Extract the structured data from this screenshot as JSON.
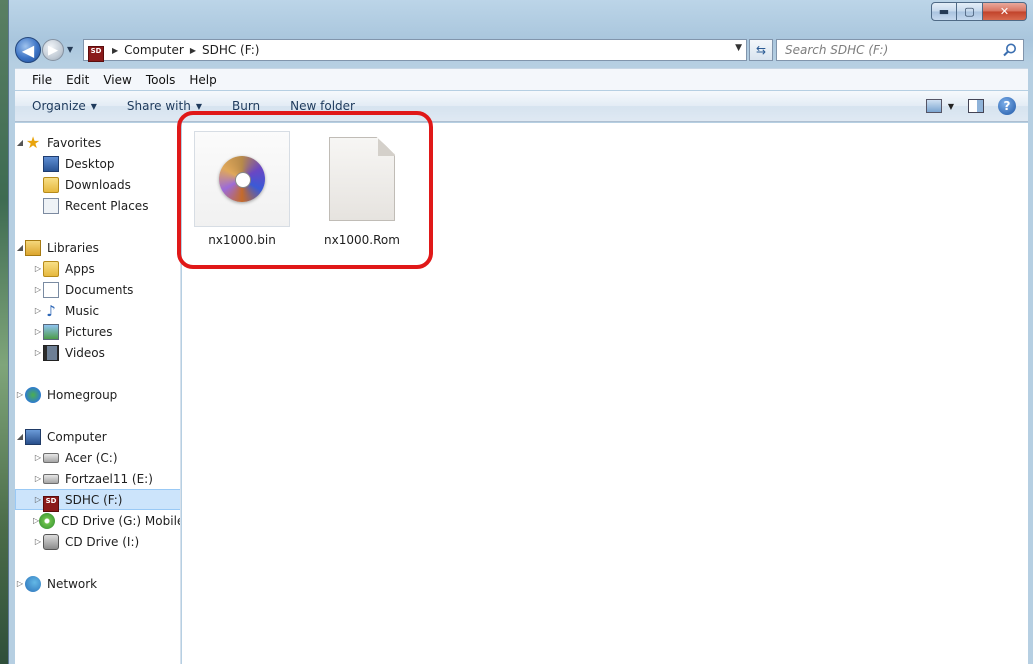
{
  "window": {
    "caption_buttons": {
      "minimize": "▬",
      "maximize": "▢",
      "close": "✕"
    }
  },
  "navigation": {
    "back": "◀",
    "forward": "▶",
    "address_icon": "SD",
    "breadcrumb": [
      "Computer",
      "SDHC (F:)"
    ],
    "search_placeholder": "Search SDHC (F:)"
  },
  "menubar": {
    "items": [
      "File",
      "Edit",
      "View",
      "Tools",
      "Help"
    ]
  },
  "commandbar": {
    "organize": "Organize",
    "share_with": "Share with",
    "burn": "Burn",
    "new_folder": "New folder",
    "help": "?"
  },
  "navpane": {
    "favorites": {
      "label": "Favorites",
      "items": [
        "Desktop",
        "Downloads",
        "Recent Places"
      ]
    },
    "libraries": {
      "label": "Libraries",
      "items": [
        "Apps",
        "Documents",
        "Music",
        "Pictures",
        "Videos"
      ]
    },
    "homegroup": {
      "label": "Homegroup"
    },
    "computer": {
      "label": "Computer",
      "items": [
        "Acer (C:)",
        "Fortzael11 (E:)",
        "SDHC (F:)",
        "CD Drive (G:) Mobile",
        "CD Drive (I:)"
      ],
      "selected": "SDHC (F:)"
    },
    "network": {
      "label": "Network"
    }
  },
  "files": [
    {
      "name": "nx1000.bin",
      "icon": "disc-image-icon"
    },
    {
      "name": "nx1000.Rom",
      "icon": "blank-file-icon"
    }
  ],
  "annotation": {
    "color": "#e01818"
  }
}
